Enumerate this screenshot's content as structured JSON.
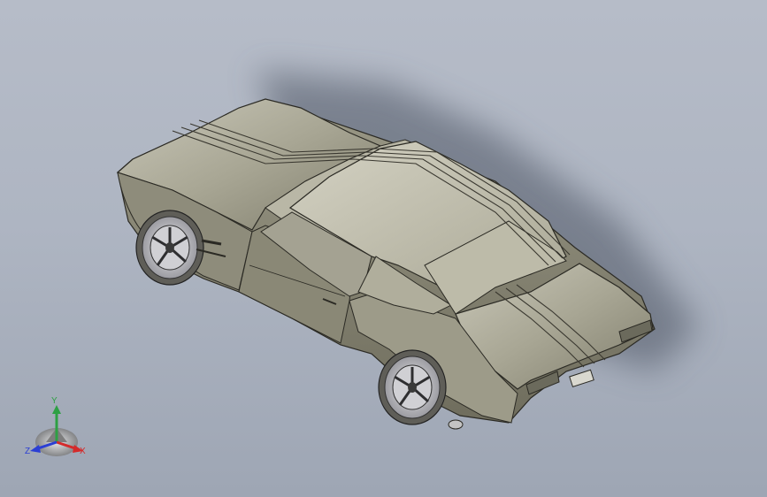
{
  "viewport": {
    "model": "car-3d-model"
  },
  "triad": {
    "x_label": "X",
    "y_label": "Y",
    "z_label": "Z",
    "colors": {
      "x": "#d42b2b",
      "y": "#2ea044",
      "z": "#2b3fd4"
    }
  }
}
